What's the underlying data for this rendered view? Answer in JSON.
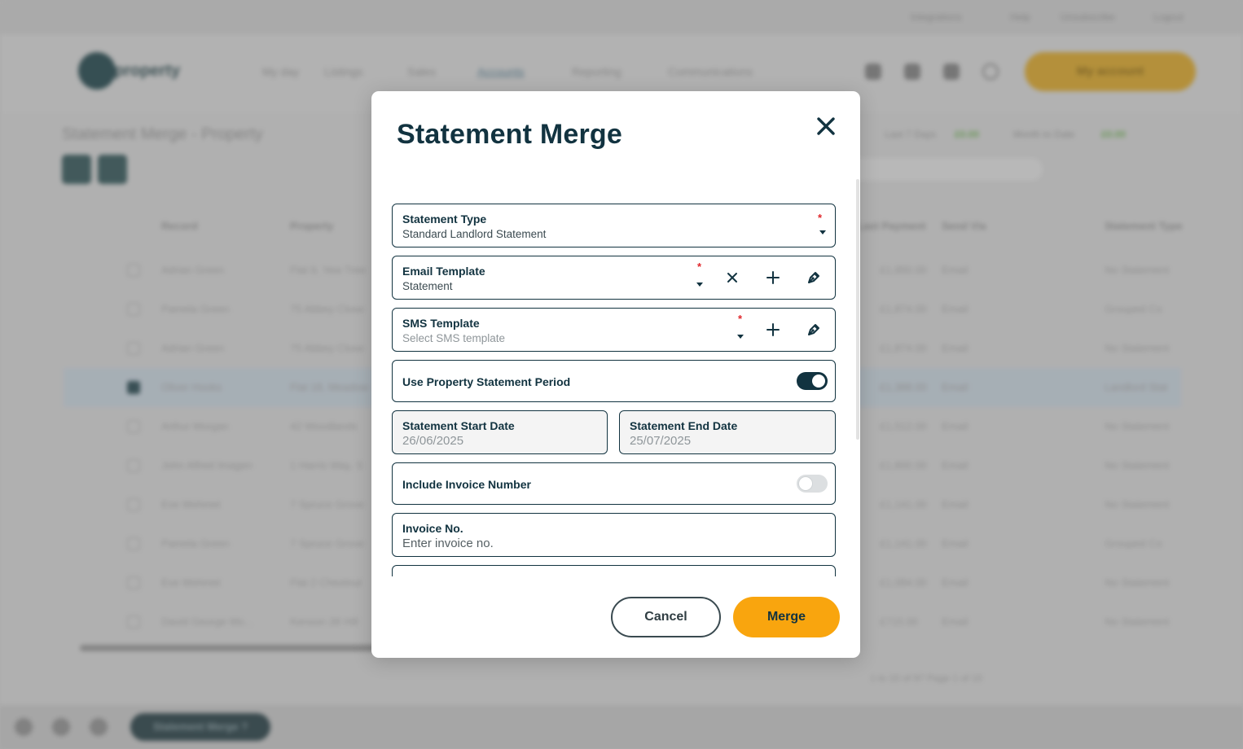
{
  "background": {
    "top_links": [
      "Integrations",
      "Help",
      "Unsubscribe",
      "Logout"
    ],
    "logo_text": "property",
    "nav": [
      "My day",
      "Listings",
      "Sales",
      "Accounts",
      "Reporting",
      "Communications"
    ],
    "account_button": "My account",
    "page_title": "Statement Merge - Property",
    "stats": [
      {
        "label": "Last 7 Days",
        "value": "£0.00"
      },
      {
        "label": "Month to Date",
        "value": "£0.00"
      }
    ],
    "columns": [
      "Record",
      "Property",
      "Last Payment",
      "Send Via",
      "Statement Type"
    ],
    "rows": [
      {
        "name": "Adrian Green",
        "property": "Flat 9, Yew Tree",
        "amount": "£1,950.00",
        "via": "Email",
        "type": "No Statement",
        "selected": false
      },
      {
        "name": "Pamela Green",
        "property": "75 Abbey Close",
        "amount": "£1,874.00",
        "via": "Email",
        "type": "Grouped Co",
        "selected": false
      },
      {
        "name": "Adrian Green",
        "property": "75 Abbey Close",
        "amount": "£1,874.00",
        "via": "Email",
        "type": "No Statement",
        "selected": false
      },
      {
        "name": "Oliver Hooks",
        "property": "Flat 18, Meadow",
        "amount": "£1,388.00",
        "via": "Email",
        "type": "Landlord Stat",
        "selected": true
      },
      {
        "name": "Arthur Morgan",
        "property": "42 Woodlands",
        "amount": "£1,512.00",
        "via": "Email",
        "type": "No Statement",
        "selected": false
      },
      {
        "name": "John Alfred Imagen",
        "property": "1 Harris Way, S",
        "amount": "£1,800.00",
        "via": "Email",
        "type": "No Statement",
        "selected": false
      },
      {
        "name": "Eve Mehmet",
        "property": "7 Spruce Grove",
        "amount": "£1,141.00",
        "via": "Email",
        "type": "No Statement",
        "selected": false
      },
      {
        "name": "Pamela Green",
        "property": "7 Spruce Grove",
        "amount": "£1,141.00",
        "via": "Email",
        "type": "Grouped Co",
        "selected": false
      },
      {
        "name": "Eve Mehmet",
        "property": "Flat 2 Chestnut",
        "amount": "£1,084.00",
        "via": "Email",
        "type": "No Statement",
        "selected": false
      },
      {
        "name": "David George Mo...",
        "property": "Kenson 28 Hill",
        "amount": "£715.00",
        "via": "Email",
        "type": "No Statement",
        "selected": false
      }
    ],
    "pagination": "1 to 10 of 97     Page 1 of 10",
    "bottom_pill": "Statement Merge ?"
  },
  "modal": {
    "title": "Statement Merge",
    "statement_type": {
      "label": "Statement Type",
      "value": "Standard Landlord Statement",
      "required_mark": "*"
    },
    "email_template": {
      "label": "Email Template",
      "value": "Statement",
      "required_mark": "*"
    },
    "sms_template": {
      "label": "SMS Template",
      "placeholder": "Select SMS template",
      "required_mark": "*"
    },
    "use_property_period": {
      "label": "Use Property Statement Period",
      "on": true
    },
    "start_date": {
      "label": "Statement Start Date",
      "value": "26/06/2025"
    },
    "end_date": {
      "label": "Statement End Date",
      "value": "25/07/2025"
    },
    "include_invoice_number": {
      "label": "Include Invoice Number",
      "on": false
    },
    "invoice_no": {
      "label": "Invoice No.",
      "placeholder": "Enter invoice no."
    },
    "cancel_label": "Cancel",
    "merge_label": "Merge",
    "colors": {
      "primary": "#123340",
      "accent": "#f9a50e",
      "required": "#e0262b"
    }
  }
}
